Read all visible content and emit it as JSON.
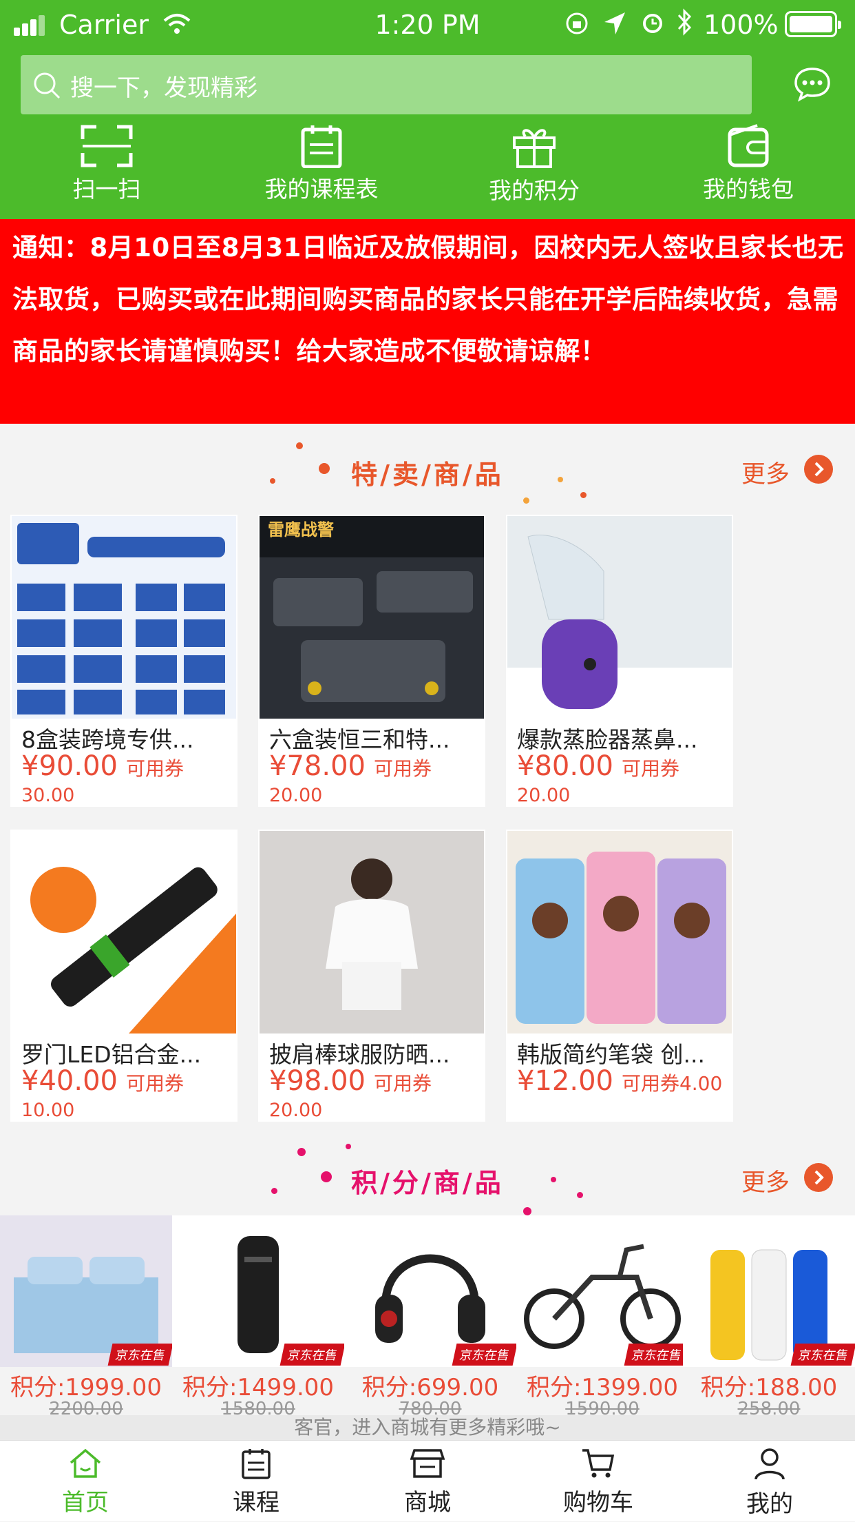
{
  "status_bar": {
    "carrier": "Carrier",
    "time": "1:20 PM",
    "battery": "100%"
  },
  "search": {
    "placeholder": "搜一下，发现精彩"
  },
  "quick_actions": [
    {
      "label": "扫一扫",
      "icon": "scan-icon"
    },
    {
      "label": "我的课程表",
      "icon": "schedule-icon"
    },
    {
      "label": "我的积分",
      "icon": "gift-icon"
    },
    {
      "label": "我的钱包",
      "icon": "wallet-icon"
    }
  ],
  "notice": {
    "text": "通知：8月10日至8月31日临近及放假期间，因校内无人签收且家长也无法取货，已购买或在此期间购买商品的家长只能在开学后陆续收货，急需商品的家长请谨慎购买！给大家造成不便敬请谅解！"
  },
  "special_section": {
    "title": "特/卖/商/品",
    "more": "更多",
    "title_color": "#e8572b"
  },
  "special_products": [
    {
      "name": "8盒装跨境专供...",
      "price": "¥90.00",
      "coupon": "可用券",
      "sub": "30.00"
    },
    {
      "name": "六盒装恒三和特...",
      "price": "¥78.00",
      "coupon": "可用券",
      "sub": "20.00"
    },
    {
      "name": "爆款蒸脸器蒸鼻...",
      "price": "¥80.00",
      "coupon": "可用券",
      "sub": "20.00"
    },
    {
      "name": "罗门LED铝合金...",
      "price": "¥40.00",
      "coupon": "可用券",
      "sub": "10.00"
    },
    {
      "name": "披肩棒球服防晒...",
      "price": "¥98.00",
      "coupon": "可用券",
      "sub": "20.00"
    },
    {
      "name": "韩版简约笔袋 创...",
      "price": "¥12.00",
      "coupon": "可用券4.00",
      "sub": ""
    }
  ],
  "points_section": {
    "title": "积/分/商/品",
    "more": "更多",
    "title_color": "#e5116b"
  },
  "points_products": [
    {
      "points": "积分:1999.00",
      "old": "2200.00",
      "badge": "京东在售"
    },
    {
      "points": "积分:1499.00",
      "old": "1580.00",
      "badge": "京东在售"
    },
    {
      "points": "积分:699.00",
      "old": "780.00",
      "badge": "京东在售"
    },
    {
      "points": "积分:1399.00",
      "old": "1590.00",
      "badge": "京东在售"
    },
    {
      "points": "积分:188.00",
      "old": "258.00",
      "badge": "京东在售"
    }
  ],
  "footer_hint": "客官，进入商城有更多精彩哦~",
  "tabs": [
    {
      "label": "首页",
      "icon": "home-icon"
    },
    {
      "label": "课程",
      "icon": "course-icon"
    },
    {
      "label": "商城",
      "icon": "shop-icon"
    },
    {
      "label": "购物车",
      "icon": "cart-icon"
    },
    {
      "label": "我的",
      "icon": "user-icon"
    }
  ],
  "colors": {
    "brand_green": "#4cbb2b",
    "notice_red": "#ff0000",
    "price_red": "#e94c37"
  }
}
